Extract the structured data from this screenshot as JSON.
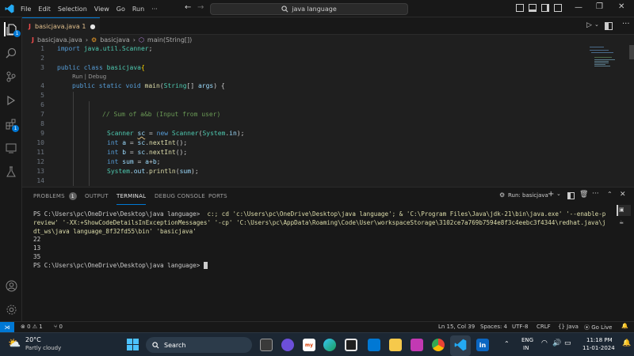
{
  "titlebar": {
    "menus": [
      "File",
      "Edit",
      "Selection",
      "View",
      "Go",
      "Run",
      "···"
    ],
    "search": "java language"
  },
  "tab": {
    "label": "basicjava.java 1"
  },
  "breadcrumb": {
    "file": "basicjava.java",
    "class": "basicjava",
    "method": "main(String[])"
  },
  "editor": {
    "codelens": "Run | Debug",
    "lines": [
      {
        "n": "1"
      },
      {
        "n": "2"
      },
      {
        "n": "3"
      },
      {
        "n": "4"
      },
      {
        "n": "5"
      },
      {
        "n": "6"
      },
      {
        "n": "7"
      },
      {
        "n": "8"
      },
      {
        "n": "9"
      },
      {
        "n": "10"
      },
      {
        "n": "11"
      },
      {
        "n": "12"
      },
      {
        "n": "13"
      },
      {
        "n": "14"
      }
    ],
    "code": {
      "l1a": "import ",
      "l1b": "java.util.Scanner",
      ";": ";",
      "l3a": "public ",
      "l3b": "class ",
      "l3c": "basicjava",
      "l3d": "{",
      "l4a": "public ",
      "l4b": "static ",
      "l4c": "void ",
      "l4d": "main",
      "l4e": "(",
      "l4f": "String",
      "l4g": "[] ",
      "l4h": "args",
      "l4i": ") {",
      "l7": "// Sum of a&b (Input from user)",
      "l9a": "Scanner ",
      "l9b": "sc",
      "l9c": " = ",
      "l9d": "new ",
      "l9e": "Scanner",
      "l9f": "(",
      "l9g": "System",
      "l9h": ".",
      "l9i": "in",
      "l9j": ");",
      "l10a": "int ",
      "l10b": "a",
      "l10c": " = ",
      "l10d": "sc",
      "l10e": ".",
      "l10f": "nextInt",
      "l10g": "();",
      "l11a": "int ",
      "l11b": "b",
      "l11c": " = ",
      "l11d": "sc",
      "l11e": ".",
      "l11f": "nextInt",
      "l11g": "();",
      "l12a": "int ",
      "l12b": "sum",
      "l12c": " = ",
      "l12d": "a",
      "l12e": "+",
      "l12f": "b",
      "l13a": "System",
      "l13b": ".",
      "l13c": "out",
      "l13d": ".",
      "l13e": "println",
      "l13f": "(",
      "l13g": "sum",
      "l13h": ");"
    }
  },
  "panel": {
    "tabs": [
      "PROBLEMS",
      "OUTPUT",
      "TERMINAL",
      "DEBUG CONSOLE",
      "PORTS"
    ],
    "problems_count": "1",
    "run_label": "Run: basicjava",
    "terminal": {
      "prompt1": "PS C:\\Users\\pc\\OneDrive\\Desktop\\java language> ",
      "cmd": " c:; cd 'c:\\Users\\pc\\OneDrive\\Desktop\\java language'; & 'C:\\Program Files\\Java\\jdk-21\\bin\\java.exe' '--enable-preview' '-XX:+ShowCodeDetailsInExceptionMessages' '-cp' 'C:\\Users\\pc\\AppData\\Roaming\\Code\\User\\workspaceStorage\\3102ce7a769b7594e8f3c4eebc3f4344\\redhat.java\\jdt_ws\\java language_8f32fd55\\bin' 'basicjava'",
      "out1": "22",
      "out2": "13",
      "out3": "35",
      "prompt2": "PS C:\\Users\\pc\\OneDrive\\Desktop\\java language> "
    }
  },
  "statusbar": {
    "errors": "0",
    "warnings": "1",
    "ports": "0",
    "position": "Ln 15, Col 39",
    "spaces": "Spaces: 4",
    "encoding": "UTF-8",
    "eol": "CRLF",
    "language": "{} Java",
    "golive": "Go Live"
  },
  "taskbar": {
    "temp": "20°C",
    "weather": "Partly cloudy",
    "search": "Search",
    "lang1": "ENG",
    "lang2": "IN",
    "time": "11:18 PM",
    "date": "11-01-2024"
  },
  "colors": {
    "accent": "#0078d4",
    "editor_bg": "#1f1f1f",
    "keyword": "#569cd6",
    "type": "#4ec9b0"
  }
}
